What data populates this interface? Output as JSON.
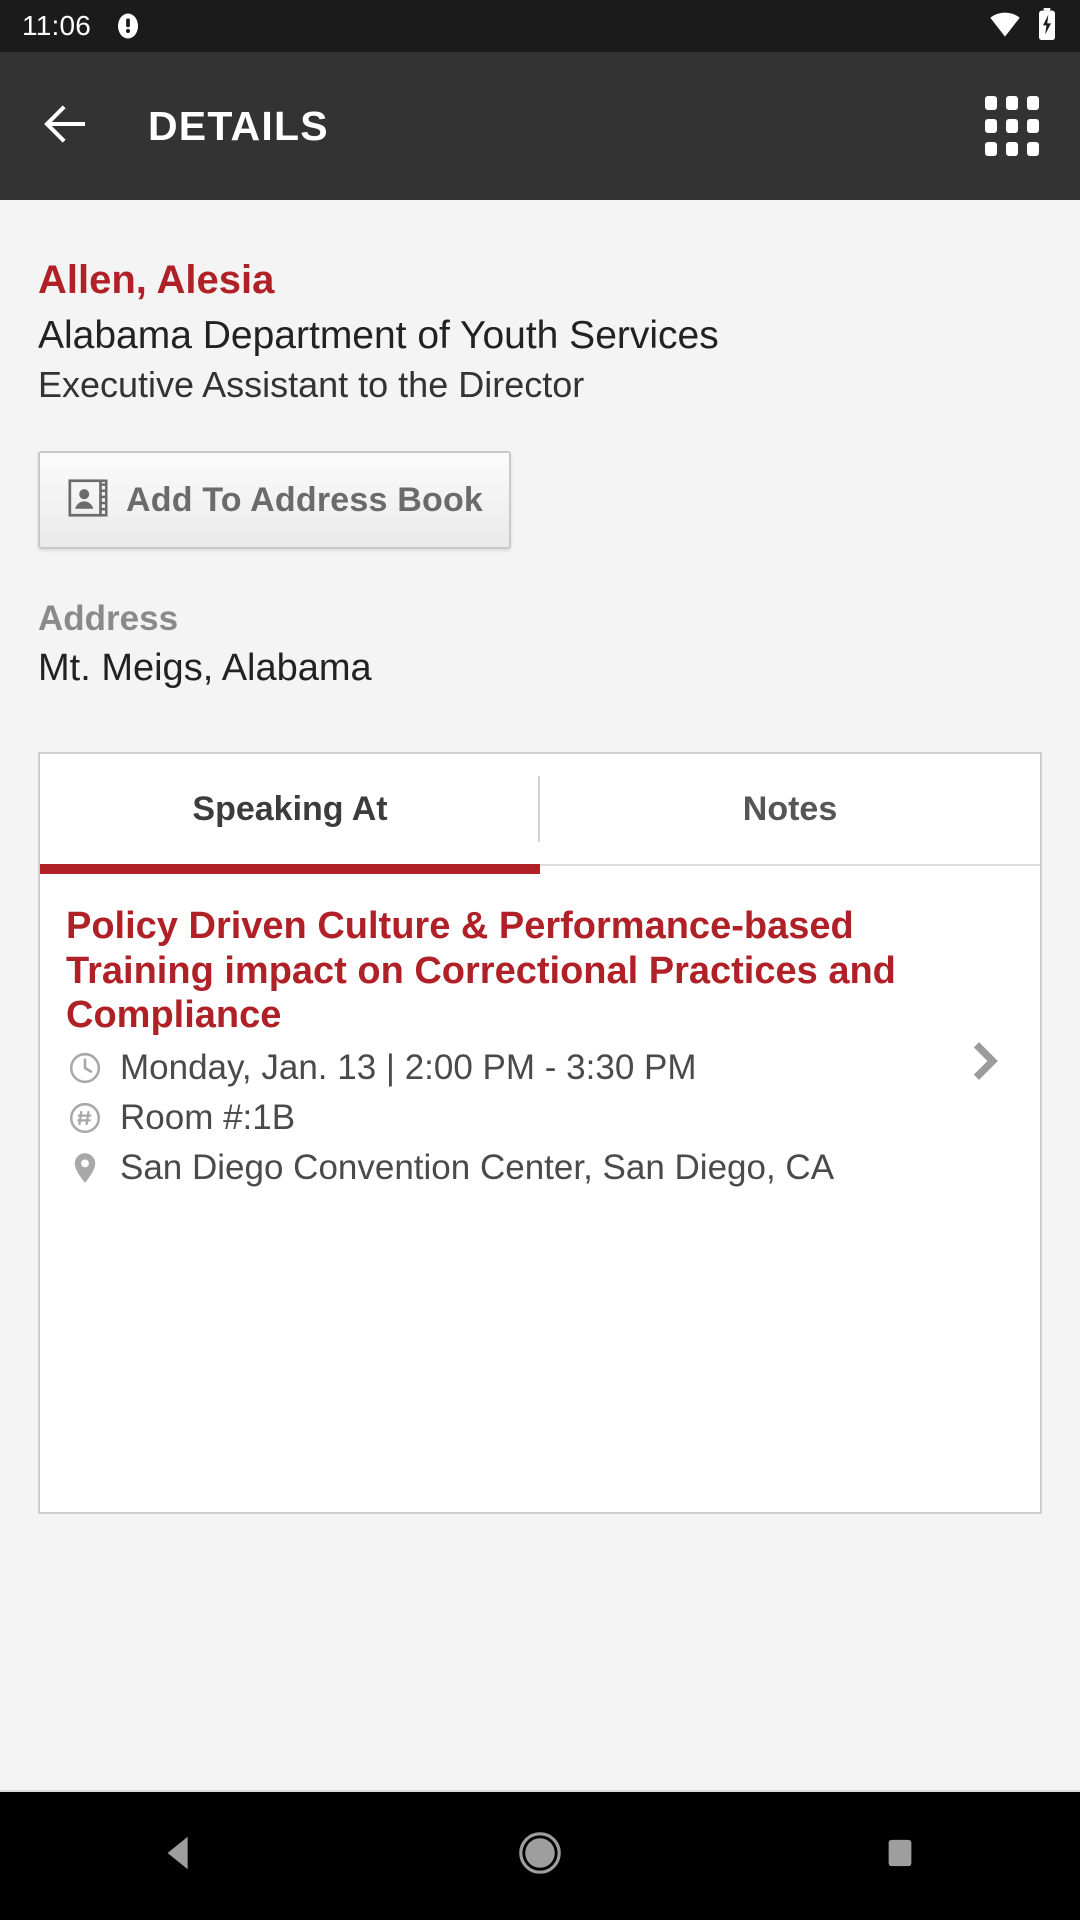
{
  "status_bar": {
    "time": "11:06",
    "icons": [
      "notification-icon",
      "wifi-icon",
      "battery-charging-icon"
    ]
  },
  "app_bar": {
    "back_icon": "arrow-back-icon",
    "title": "DETAILS",
    "menu_icon": "apps-grid-icon"
  },
  "person": {
    "name": "Allen, Alesia",
    "organization": "Alabama Department of Youth Services",
    "job_title": "Executive Assistant to the Director",
    "name_color": "#b02127"
  },
  "add_to_address_book": {
    "label": "Add To Address Book",
    "icon": "contact-card-icon"
  },
  "address": {
    "label": "Address",
    "value": "Mt. Meigs, Alabama"
  },
  "tabs": [
    {
      "label": "Speaking At",
      "active": true
    },
    {
      "label": "Notes",
      "active": false
    }
  ],
  "tab_indicator_color": "#b02127",
  "session": {
    "title": "Policy Driven Culture & Performance-based Training impact on Correctional Practices and Compliance",
    "time": "Monday, Jan. 13 | 2:00 PM - 3:30 PM",
    "room": "Room #:1B",
    "venue": "San Diego Convention Center, San Diego, CA",
    "time_icon": "clock-icon",
    "room_icon": "hash-circle-icon",
    "venue_icon": "location-pin-icon",
    "chevron_icon": "chevron-right-icon"
  },
  "nav_bar": {
    "back": "nav-back-triangle-icon",
    "home": "nav-home-circle-icon",
    "recents": "nav-recents-square-icon"
  }
}
